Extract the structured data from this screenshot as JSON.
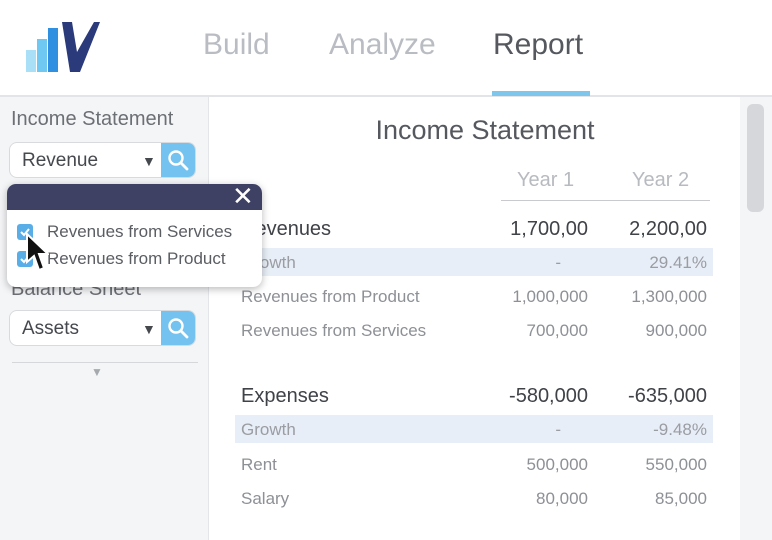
{
  "nav": {
    "tabs": [
      {
        "label": "Build",
        "active": false
      },
      {
        "label": "Analyze",
        "active": false
      },
      {
        "label": "Report",
        "active": true
      }
    ]
  },
  "sidebar": {
    "sections": [
      {
        "heading": "Income Statement",
        "selected": "Revenue"
      },
      {
        "heading": "Balance Sheet",
        "selected": "Assets"
      }
    ]
  },
  "popup": {
    "close_glyph": "✕",
    "items": [
      {
        "label": "Revenues from Services",
        "checked": true
      },
      {
        "label": "Revenues from Product",
        "checked": true
      }
    ]
  },
  "report": {
    "title": "Income Statement",
    "columns": [
      "Year 1",
      "Year 2"
    ],
    "rows": [
      {
        "label": "Revenues",
        "y1": "1,700,00",
        "y2": "2,200,00",
        "kind": "section"
      },
      {
        "label": "Growth",
        "y1": "-",
        "y2": "29.41%",
        "kind": "growth"
      },
      {
        "label": "Revenues from Product",
        "y1": "1,000,000",
        "y2": "1,300,000",
        "kind": "plain"
      },
      {
        "label": "Revenues from Services",
        "y1": "700,000",
        "y2": "900,000",
        "kind": "plain"
      },
      {
        "label": "Expenses",
        "y1": "-580,000",
        "y2": "-635,000",
        "kind": "section"
      },
      {
        "label": "Growth",
        "y1": "-",
        "y2": "-9.48%",
        "kind": "growth"
      },
      {
        "label": "Rent",
        "y1": "500,000",
        "y2": "550,000",
        "kind": "plain"
      },
      {
        "label": "Salary",
        "y1": "80,000",
        "y2": "85,000",
        "kind": "plain"
      }
    ]
  },
  "icons": {
    "logo": "bar-chart-check-logo",
    "search": "search-icon",
    "dropdown": "caret-down-icon",
    "close": "close-icon",
    "checkbox": "checkbox-checked-icon",
    "cursor": "mouse-pointer-icon"
  },
  "colors": {
    "accent": "#74c2ef",
    "popup_header": "#3e4064",
    "active_tab": "#55585e",
    "inactive_tab": "#b9bcc2",
    "growth_row_bg": "#e8eef7"
  }
}
